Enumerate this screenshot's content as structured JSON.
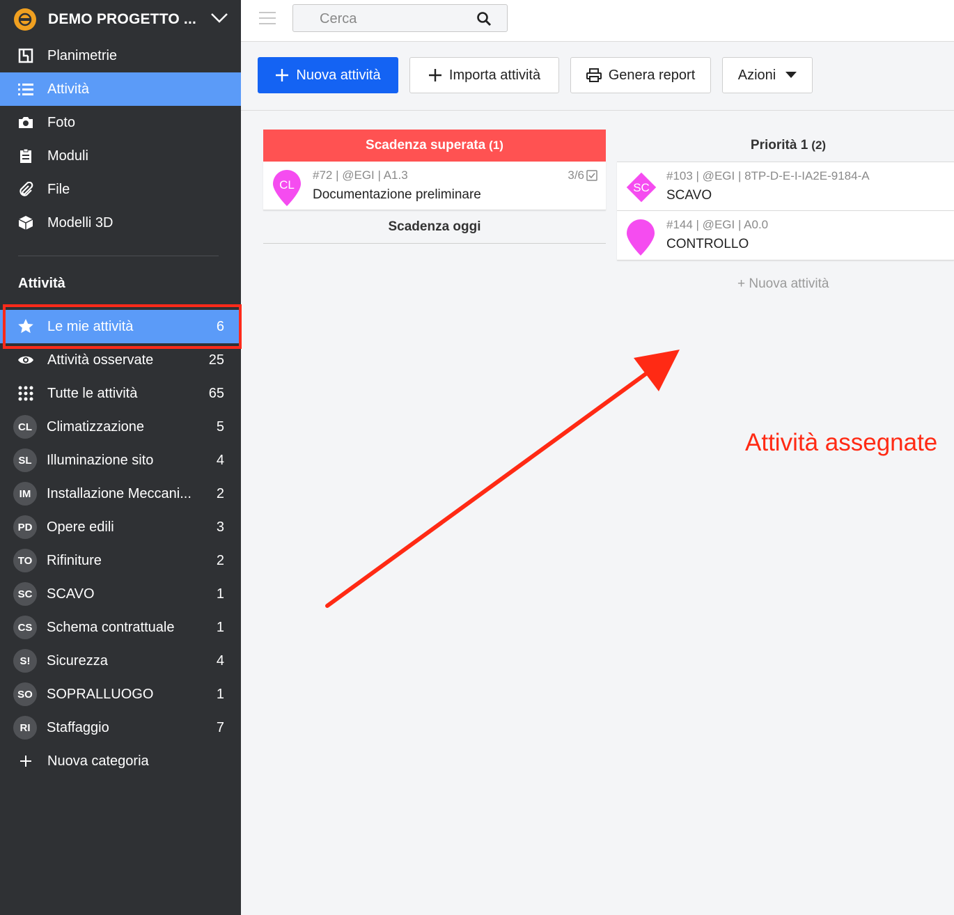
{
  "project": {
    "title": "DEMO PROGETTO ..."
  },
  "nav": [
    {
      "label": "Planimetrie",
      "icon": "floorplan-icon"
    },
    {
      "label": "Attività",
      "icon": "list-icon"
    },
    {
      "label": "Foto",
      "icon": "camera-icon"
    },
    {
      "label": "Moduli",
      "icon": "clipboard-icon"
    },
    {
      "label": "File",
      "icon": "paperclip-icon"
    },
    {
      "label": "Modelli 3D",
      "icon": "cube-icon"
    }
  ],
  "section_title": "Attività",
  "filters": [
    {
      "label": "Le mie attività",
      "count": "6",
      "icon": "star-icon"
    },
    {
      "label": "Attività osservate",
      "count": "25",
      "icon": "eye-icon"
    },
    {
      "label": "Tutte le attività",
      "count": "65",
      "icon": "grid-dots-icon"
    }
  ],
  "categories": [
    {
      "badge": "CL",
      "label": "Climatizzazione",
      "count": "5"
    },
    {
      "badge": "SL",
      "label": "Illuminazione sito",
      "count": "4"
    },
    {
      "badge": "IM",
      "label": "Installazione Meccani...",
      "count": "2"
    },
    {
      "badge": "PD",
      "label": "Opere edili",
      "count": "3"
    },
    {
      "badge": "TO",
      "label": "Rifiniture",
      "count": "2"
    },
    {
      "badge": "SC",
      "label": "SCAVO",
      "count": "1"
    },
    {
      "badge": "CS",
      "label": "Schema contrattuale",
      "count": "1"
    },
    {
      "badge": "S!",
      "label": "Sicurezza",
      "count": "4"
    },
    {
      "badge": "SO",
      "label": "SOPRALLUOGO",
      "count": "1"
    },
    {
      "badge": "RI",
      "label": "Staffaggio",
      "count": "7"
    }
  ],
  "new_category": "Nuova categoria",
  "search": {
    "placeholder": "Cerca"
  },
  "toolbar": {
    "new_activity": "Nuova attività",
    "import": "Importa attività",
    "report": "Genera report",
    "actions": "Azioni"
  },
  "board": {
    "overdue": {
      "title": "Scadenza superata",
      "count": "(1)"
    },
    "overdue_card": {
      "meta": "#72 | @EGI | A1.3",
      "title": "Documentazione preliminare",
      "progress": "3/6",
      "pin_label": "CL"
    },
    "today": {
      "title": "Scadenza oggi"
    },
    "priority": {
      "title": "Priorità 1",
      "count": "(2)"
    },
    "priority_cards": [
      {
        "meta": "#103 | @EGI | 8TP-D-E-I-IA2E-9184-A",
        "title": "SCAVO",
        "pin_label": "SC"
      },
      {
        "meta": "#144 | @EGI | A0.0",
        "title": "CONTROLLO",
        "pin_label": ""
      }
    ],
    "add_activity": "+ Nuova attività"
  },
  "annotation": "Attività assegnate",
  "colors": {
    "sidebar": "#2f3134",
    "active": "#5b9bf8",
    "primary": "#1463f3",
    "overdue": "#ff5252",
    "pin": "#f54cf0",
    "annotation": "#ff2a14"
  }
}
